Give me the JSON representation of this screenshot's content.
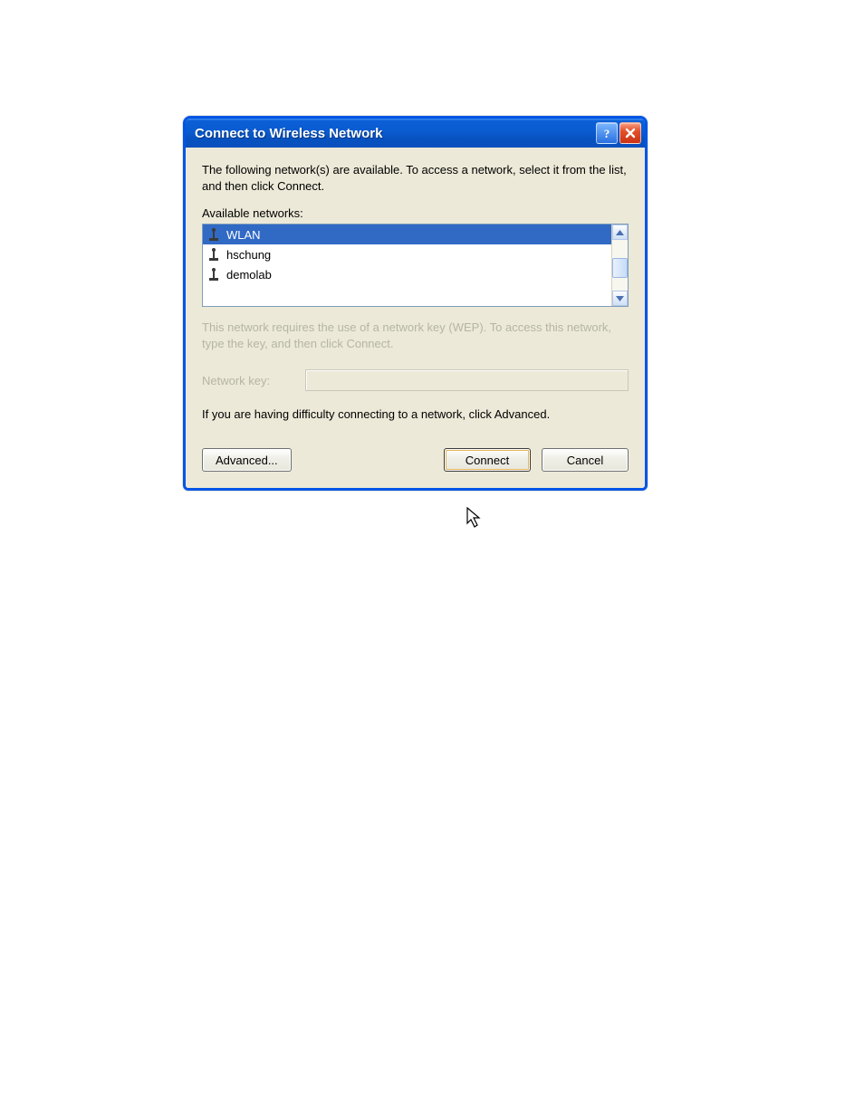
{
  "titlebar": {
    "title": "Connect to Wireless Network"
  },
  "body": {
    "instruction": "The following network(s) are available. To access a network, select it from the list, and then click Connect.",
    "available_label": "Available networks:",
    "networks": [
      {
        "name": "WLAN"
      },
      {
        "name": "hschung"
      },
      {
        "name": "demolab"
      }
    ],
    "wep_note": "This network requires the use of a network key (WEP). To access this network, type the key, and then click Connect.",
    "network_key_label": "Network key:",
    "network_key_value": "",
    "difficulty_text": "If you are having difficulty connecting to a network, click Advanced.",
    "buttons": {
      "advanced": "Advanced...",
      "connect": "Connect",
      "cancel": "Cancel"
    }
  }
}
